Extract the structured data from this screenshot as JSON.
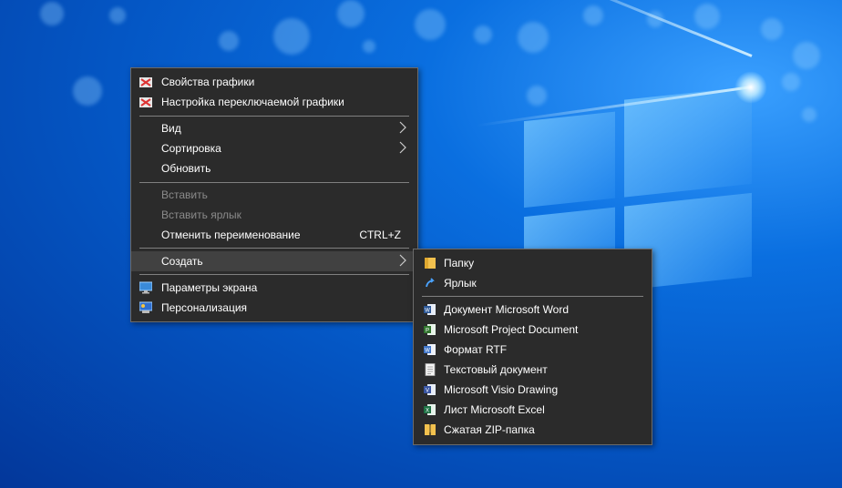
{
  "context_menu": {
    "items": [
      {
        "label": "Свойства графики",
        "icon": "intel-graphics-icon"
      },
      {
        "label": "Настройка переключаемой графики",
        "icon": "intel-graphics-icon"
      },
      {
        "label": "Вид",
        "submenu": true
      },
      {
        "label": "Сортировка",
        "submenu": true
      },
      {
        "label": "Обновить"
      },
      {
        "label": "Вставить",
        "disabled": true
      },
      {
        "label": "Вставить ярлык",
        "disabled": true
      },
      {
        "label": "Отменить переименование",
        "shortcut": "CTRL+Z"
      },
      {
        "label": "Создать",
        "submenu": true,
        "highlighted": true
      },
      {
        "label": "Параметры экрана",
        "icon": "display-settings-icon"
      },
      {
        "label": "Персонализация",
        "icon": "personalization-icon"
      }
    ]
  },
  "submenu_create": {
    "items": [
      {
        "label": "Папку",
        "icon": "folder-icon"
      },
      {
        "label": "Ярлык",
        "icon": "shortcut-icon"
      },
      {
        "label": "Документ Microsoft Word",
        "icon": "word-icon"
      },
      {
        "label": "Microsoft Project Document",
        "icon": "project-icon"
      },
      {
        "label": "Формат RTF",
        "icon": "wordpad-icon"
      },
      {
        "label": "Текстовый документ",
        "icon": "text-document-icon"
      },
      {
        "label": "Microsoft Visio Drawing",
        "icon": "visio-icon"
      },
      {
        "label": "Лист Microsoft Excel",
        "icon": "excel-icon"
      },
      {
        "label": "Сжатая ZIP-папка",
        "icon": "zip-folder-icon"
      }
    ]
  },
  "colors": {
    "menu_bg": "#2b2b2b",
    "menu_border": "#6b6b6b",
    "highlight_bg": "#414141",
    "text": "#ffffff",
    "disabled_text": "#8a8a8a",
    "desktop_blue": "#0a6fe0"
  }
}
